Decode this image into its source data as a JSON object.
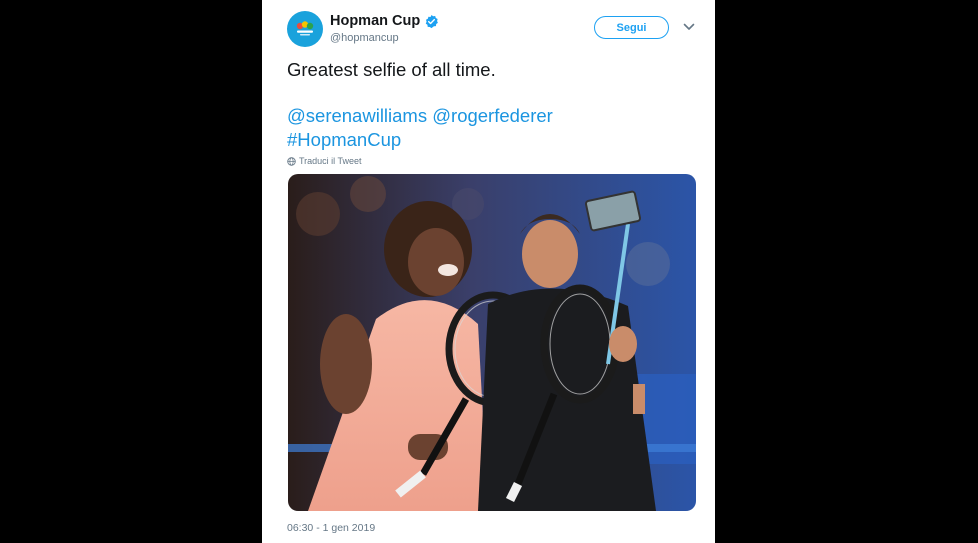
{
  "tweet": {
    "display_name": "Hopman Cup",
    "handle": "@hopmancup",
    "follow_label": "Segui",
    "text_line1": "Greatest selfie of all time.",
    "mention1": "@serenawilliams",
    "mention2": "@rogerfederer",
    "hashtag": "#HopmanCup",
    "translate_label": "Traduci il Tweet",
    "timestamp": "06:30 - 1 gen 2019"
  },
  "icons": {
    "verified": "verified-badge-icon",
    "caret": "chevron-down-icon",
    "globe": "globe-icon"
  },
  "colors": {
    "link_blue": "#1b95e0",
    "follow_blue": "#1da1f2",
    "avatar_bg": "#1aa2dc"
  }
}
